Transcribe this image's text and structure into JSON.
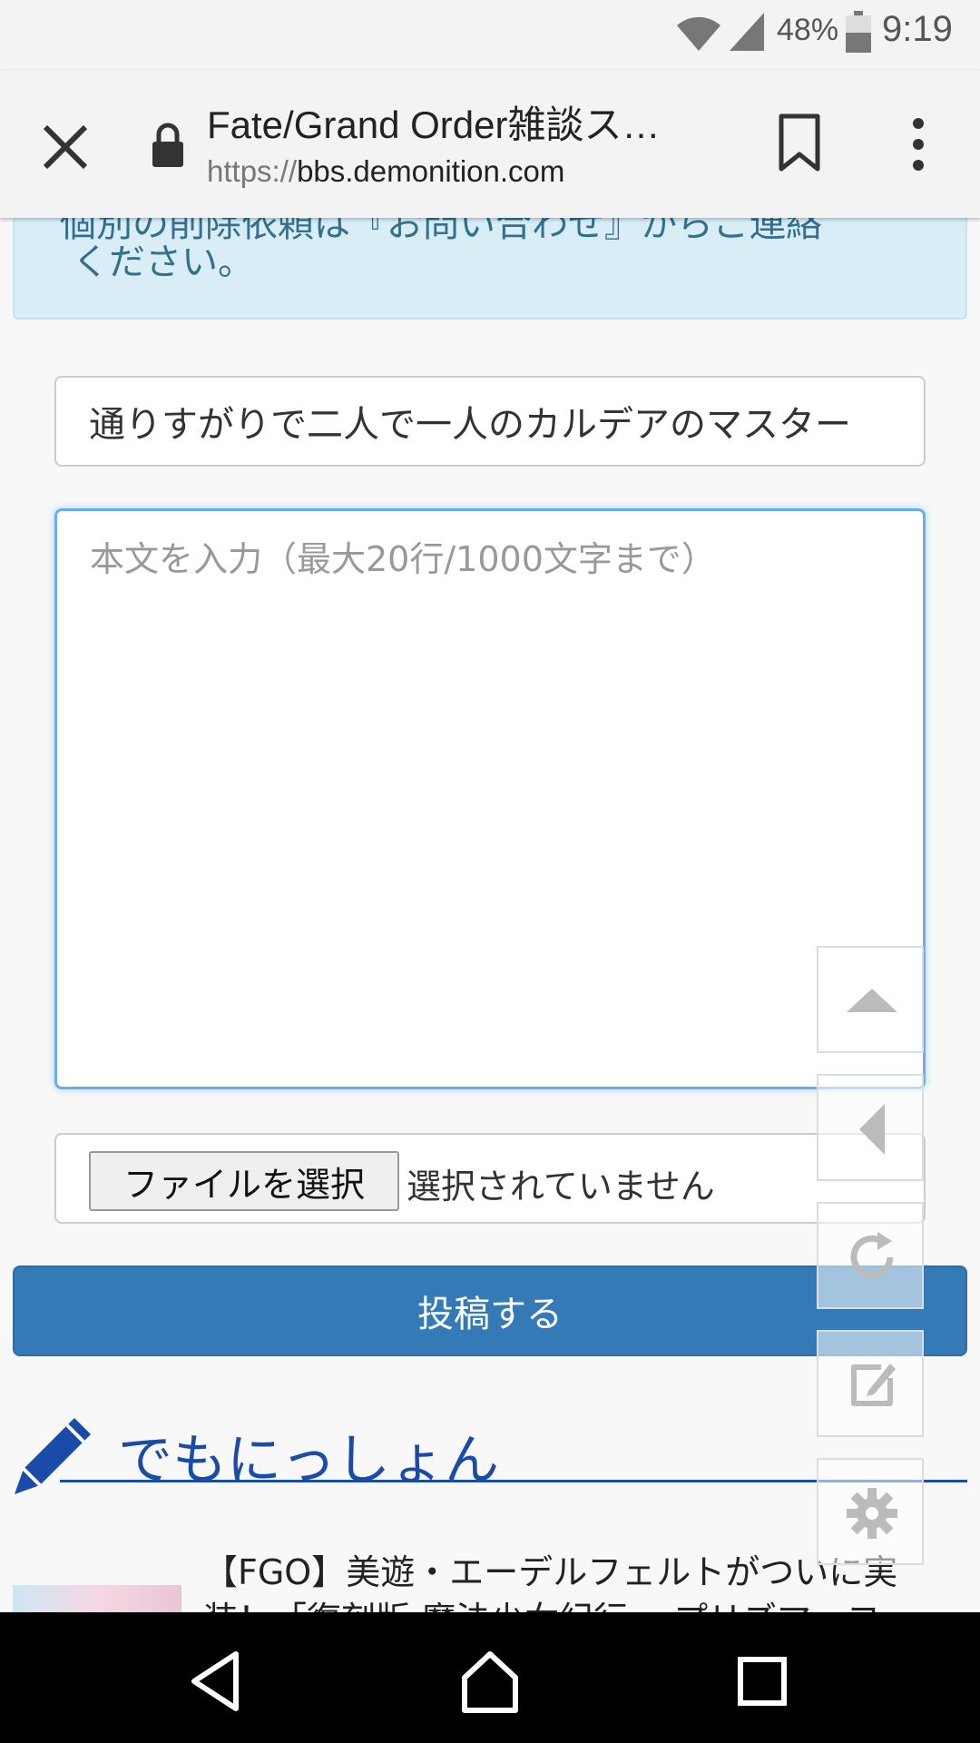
{
  "status_bar": {
    "battery": "48%",
    "time": "9:19"
  },
  "browser": {
    "title": "Fate/Grand Order雑談ス…",
    "url_scheme": "https://",
    "url_host": "bbs.demonition.com"
  },
  "notice": {
    "line1": "個別の削除依頼は『お問い合わせ』からご連絡",
    "line2": "ください。"
  },
  "form": {
    "name_value": "通りすがりで二人で一人のカルデアのマスター",
    "body_placeholder": "本文を入力（最大20行/1000文字まで）",
    "file_button_label": "ファイルを選択",
    "file_status": "選択されていません",
    "submit_label": "投稿する"
  },
  "site": {
    "heading": "でもにっしょん"
  },
  "article": {
    "title": "【FGO】美遊・エーデルフェルトがついに実装！「復刻版 魔法少女紀行 ～プリズマ・コ"
  },
  "colors": {
    "accent": "#337ab7",
    "notice_bg": "#d9edf7",
    "heading": "#1a4ba8"
  }
}
